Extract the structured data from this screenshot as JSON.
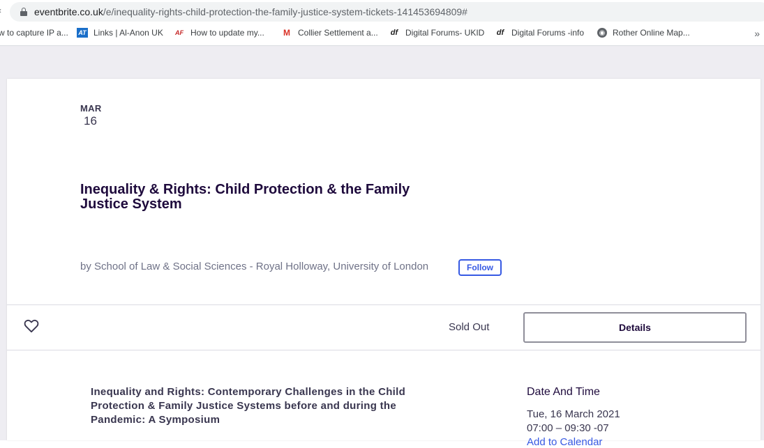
{
  "browser": {
    "back_hint": "‹",
    "url_domain": "eventbrite.co.uk",
    "url_path": "/e/inequality-rights-child-protection-the-family-justice-system-tickets-141453694809#",
    "bookmarks": [
      {
        "label": "w to capture IP a...",
        "icon": "none"
      },
      {
        "label": "Links | Al-Anon UK",
        "icon": "at-icon",
        "glyph": "AT"
      },
      {
        "label": "How to update my...",
        "icon": "af-icon",
        "glyph": "AF"
      },
      {
        "label": "Collier Settlement a...",
        "icon": "gmail-icon",
        "glyph": "M"
      },
      {
        "label": "Digital Forums- UKID",
        "icon": "df-icon",
        "glyph": "df"
      },
      {
        "label": "Digital Forums -info",
        "icon": "df-icon",
        "glyph": "df"
      },
      {
        "label": "Rother Online Map...",
        "icon": "globe-icon",
        "glyph": "◉"
      }
    ],
    "more_bookmarks": "»"
  },
  "event": {
    "month": "MAR",
    "day": "16",
    "title": "Inequality & Rights: Child Protection & the Family Justice System",
    "organizer": "by School of Law & Social Sciences - Royal Holloway, University of London",
    "follow_label": "Follow",
    "status": "Sold Out",
    "details_label": "Details",
    "summary": "Inequality and Rights: Contemporary Challenges in the Child Protection & Family Justice Systems before and during the Pandemic: A Symposium",
    "date_time_heading": "Date And Time",
    "date_line": "Tue, 16 March 2021",
    "time_line": "07:00 – 09:30 -07",
    "add_to_calendar": "Add to Calendar"
  },
  "colors": {
    "accent": "#3659e3",
    "title": "#1e0a3c",
    "page_bg": "#eeedf2"
  }
}
